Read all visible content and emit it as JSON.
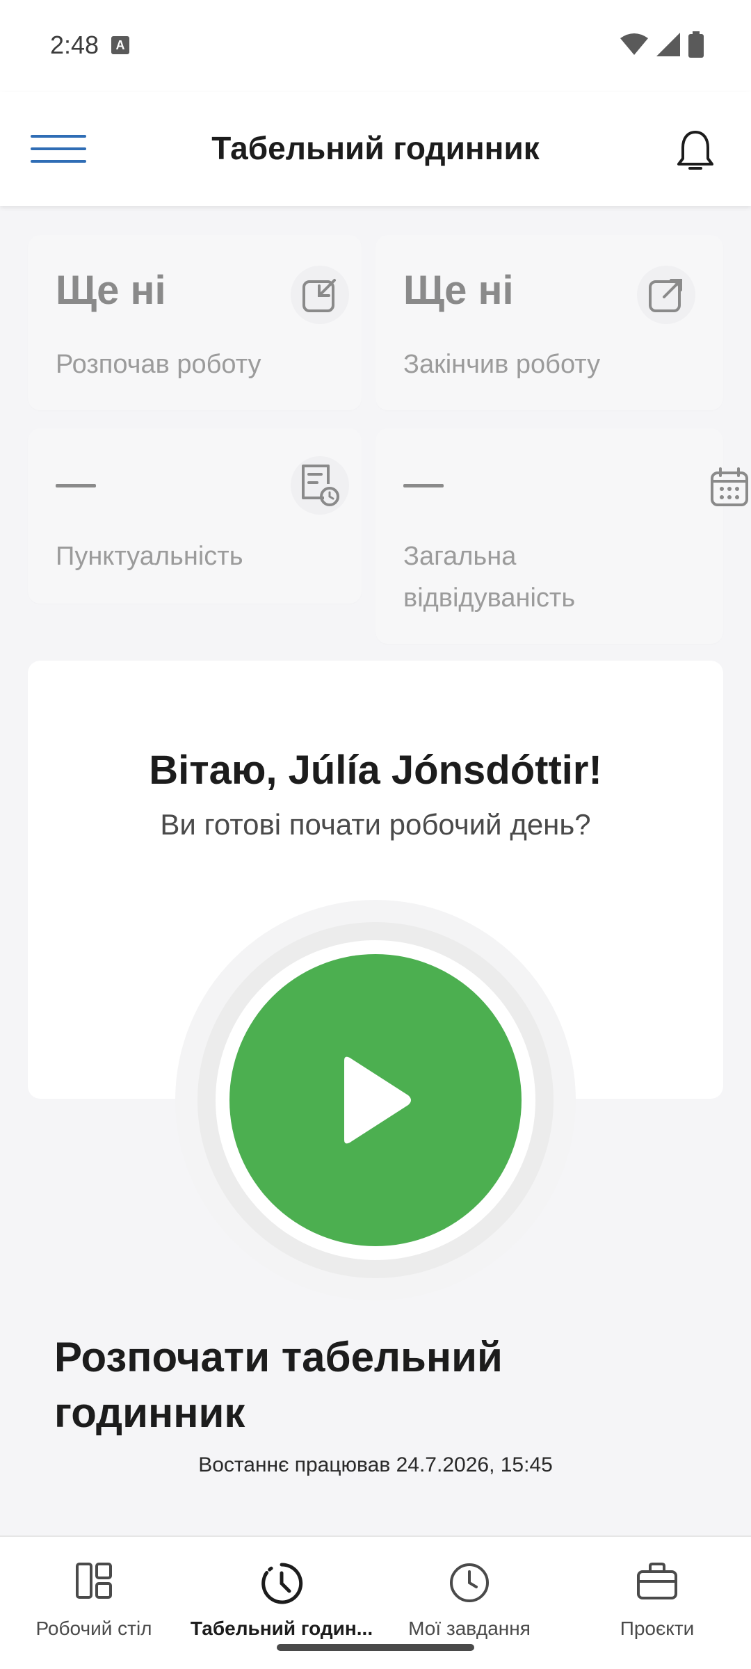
{
  "status_bar": {
    "time": "2:48",
    "notification_icon": "a-icon"
  },
  "header": {
    "title": "Табельний годинник"
  },
  "stats": {
    "started": {
      "value": "Ще ні",
      "label": "Розпочав роботу",
      "icon": "clock-in-icon"
    },
    "finished": {
      "value": "Ще ні",
      "label": "Закінчив роботу",
      "icon": "clock-out-icon"
    },
    "punctuality": {
      "value": "—",
      "label": "Пунктуальність",
      "icon": "punctuality-icon"
    },
    "attendance": {
      "value": "—",
      "label_line1": "Загальна",
      "label_line2": "відвідуваність",
      "icon": "calendar-icon"
    }
  },
  "welcome": {
    "title": "Вітаю, Júlía Jónsdóttir!",
    "subtitle": "Ви готові почати робочий день?"
  },
  "start": {
    "heading_line1": "Розпочати табельний",
    "heading_line2": "годинник",
    "last_worked": "Востаннє працював 24.7.2026, 15:45",
    "button_color": "#4caf50"
  },
  "nav": {
    "items": [
      {
        "label": "Робочий стіл",
        "icon": "dashboard-icon"
      },
      {
        "label": "Табельний годин...",
        "icon": "time-clock-icon",
        "active": true
      },
      {
        "label": "Мої завдання",
        "icon": "clock-icon"
      },
      {
        "label": "Проєкти",
        "icon": "briefcase-icon"
      }
    ]
  },
  "colors": {
    "accent": "#2f6db5",
    "start_green": "#4caf50"
  }
}
